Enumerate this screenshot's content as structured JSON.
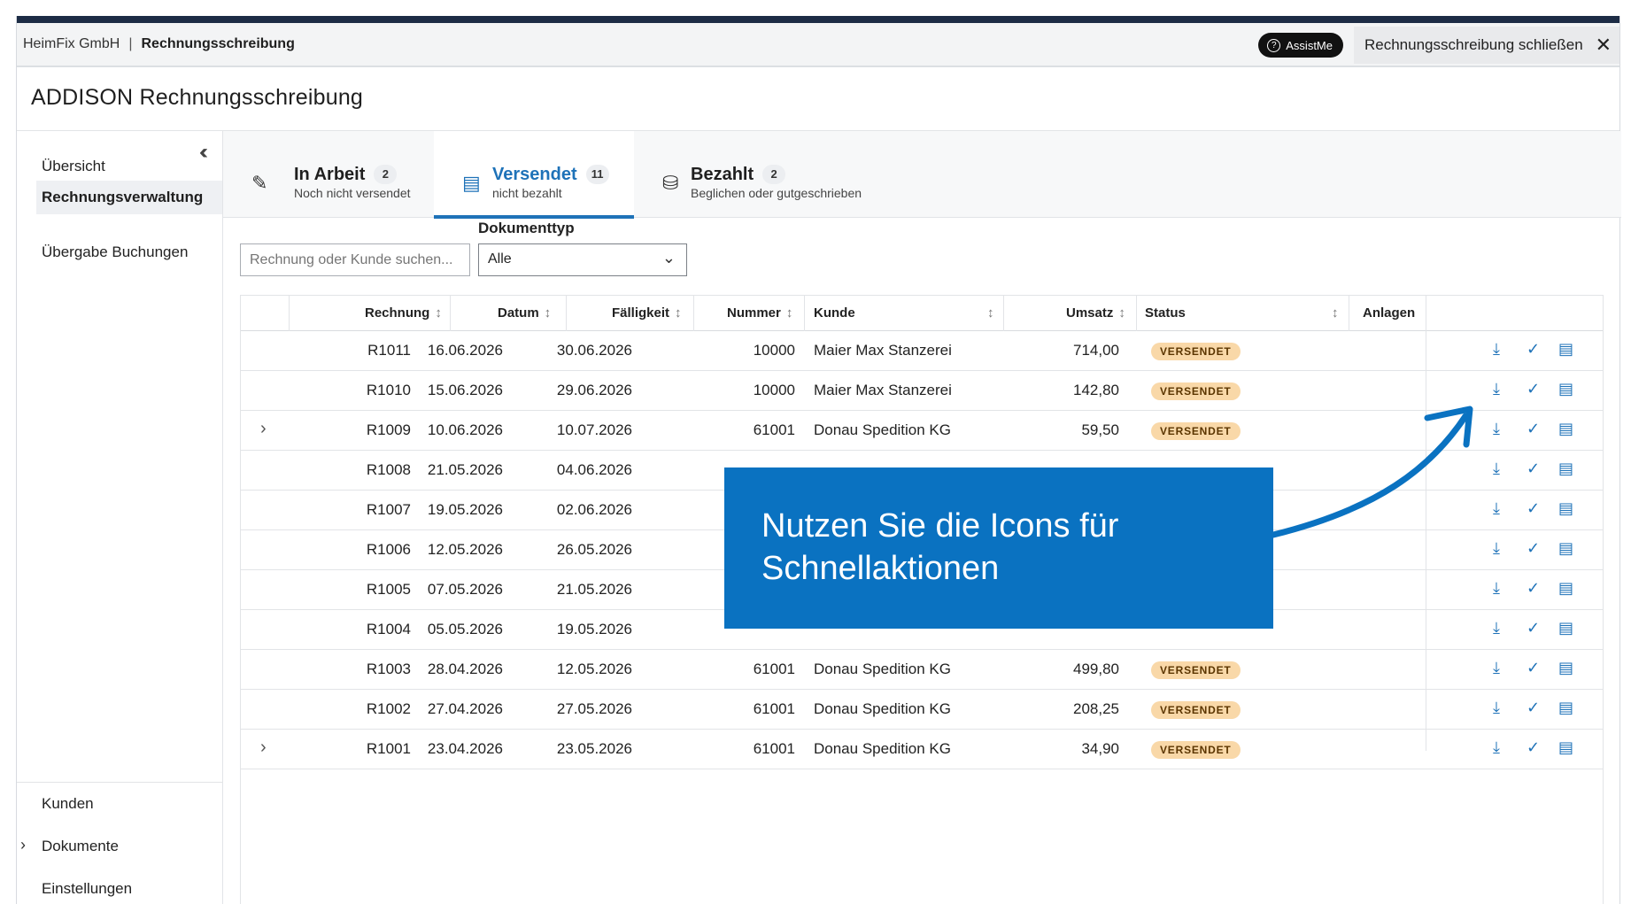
{
  "topbar": {
    "company": "HeimFix GmbH",
    "separator": "|",
    "module": "Rechnungsschreibung",
    "assist_label": "AssistMe",
    "close_label": "Rechnungsschreibung schließen"
  },
  "app_title": "ADDISON Rechnungsschreibung",
  "sidebar": {
    "items": [
      {
        "label": "Übersicht"
      },
      {
        "label": "Rechnungsverwaltung"
      },
      {
        "label": "Übergabe Buchungen"
      }
    ],
    "bottom_items": [
      {
        "label": "Kunden"
      },
      {
        "label": "Dokumente"
      },
      {
        "label": "Einstellungen"
      }
    ]
  },
  "tabs": [
    {
      "label": "In Arbeit",
      "count": "2",
      "sub": "Noch nicht versendet",
      "icon": "pencil-icon"
    },
    {
      "label": "Versendet",
      "count": "11",
      "sub": "nicht bezahlt",
      "icon": "receipt-icon"
    },
    {
      "label": "Bezahlt",
      "count": "2",
      "sub": "Beglichen oder gutgeschrieben",
      "icon": "coins-icon"
    }
  ],
  "filters": {
    "search_placeholder": "Rechnung oder Kunde suchen...",
    "doctype_label": "Dokumenttyp",
    "doctype_value": "Alle"
  },
  "table": {
    "headers": {
      "rechnung": "Rechnung",
      "datum": "Datum",
      "faelligkeit": "Fälligkeit",
      "nummer": "Nummer",
      "kunde": "Kunde",
      "umsatz": "Umsatz",
      "status": "Status",
      "anlagen": "Anlagen"
    },
    "rows": [
      {
        "rechnung": "R1011",
        "datum": "16.06.2026",
        "faellig": "30.06.2026",
        "nummer": "10000",
        "kunde": "Maier Max Stanzerei",
        "umsatz": "714,00",
        "status": "VERSENDET"
      },
      {
        "rechnung": "R1010",
        "datum": "15.06.2026",
        "faellig": "29.06.2026",
        "nummer": "10000",
        "kunde": "Maier Max Stanzerei",
        "umsatz": "142,80",
        "status": "VERSENDET"
      },
      {
        "rechnung": "R1009",
        "datum": "10.06.2026",
        "faellig": "10.07.2026",
        "nummer": "61001",
        "kunde": "Donau Spedition KG",
        "umsatz": "59,50",
        "status": "VERSENDET"
      },
      {
        "rechnung": "R1008",
        "datum": "21.05.2026",
        "faellig": "04.06.2026",
        "nummer": "",
        "kunde": "",
        "umsatz": "",
        "status": ""
      },
      {
        "rechnung": "R1007",
        "datum": "19.05.2026",
        "faellig": "02.06.2026",
        "nummer": "",
        "kunde": "",
        "umsatz": "",
        "status": ""
      },
      {
        "rechnung": "R1006",
        "datum": "12.05.2026",
        "faellig": "26.05.2026",
        "nummer": "",
        "kunde": "",
        "umsatz": "",
        "status": ""
      },
      {
        "rechnung": "R1005",
        "datum": "07.05.2026",
        "faellig": "21.05.2026",
        "nummer": "",
        "kunde": "",
        "umsatz": "",
        "status": ""
      },
      {
        "rechnung": "R1004",
        "datum": "05.05.2026",
        "faellig": "19.05.2026",
        "nummer": "",
        "kunde": "",
        "umsatz": "",
        "status": ""
      },
      {
        "rechnung": "R1003",
        "datum": "28.04.2026",
        "faellig": "12.05.2026",
        "nummer": "61001",
        "kunde": "Donau Spedition KG",
        "umsatz": "499,80",
        "status": "VERSENDET"
      },
      {
        "rechnung": "R1002",
        "datum": "27.04.2026",
        "faellig": "27.05.2026",
        "nummer": "61001",
        "kunde": "Donau Spedition KG",
        "umsatz": "208,25",
        "status": "VERSENDET"
      },
      {
        "rechnung": "R1001",
        "datum": "23.04.2026",
        "faellig": "23.05.2026",
        "nummer": "61001",
        "kunde": "Donau Spedition KG",
        "umsatz": "34,90",
        "status": "VERSENDET"
      }
    ]
  },
  "callout": {
    "text": "Nutzen Sie die Icons für Schnellaktionen"
  },
  "colors": {
    "accent": "#1e72b8",
    "callout": "#0a72c1",
    "badge_bg": "#f9d8a8",
    "header_stripe": "#1d2c45"
  }
}
